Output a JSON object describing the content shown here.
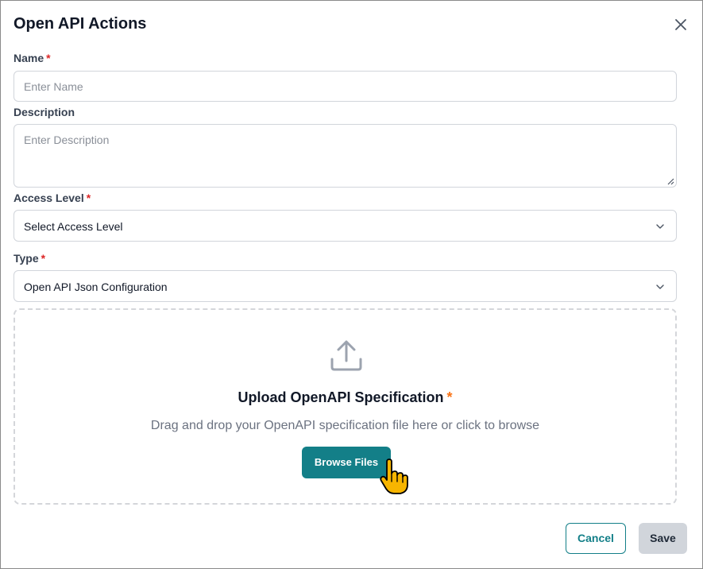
{
  "dialog": {
    "title": "Open API Actions",
    "close_icon": "close-icon"
  },
  "form": {
    "name": {
      "label": "Name",
      "required_mark": "*",
      "placeholder": "Enter Name",
      "value": ""
    },
    "description": {
      "label": "Description",
      "placeholder": "Enter Description",
      "value": ""
    },
    "access_level": {
      "label": "Access Level",
      "required_mark": "*",
      "selected": "Select Access Level"
    },
    "type": {
      "label": "Type",
      "required_mark": "*",
      "selected": "Open API Json Configuration"
    }
  },
  "upload": {
    "icon": "upload-icon",
    "title": "Upload OpenAPI Specification",
    "required_mark": "*",
    "subtitle": "Drag and drop your OpenAPI specification file here or click to browse",
    "browse_label": "Browse Files"
  },
  "footer": {
    "cancel_label": "Cancel",
    "save_label": "Save"
  },
  "colors": {
    "accent": "#137f88",
    "required": "#dc2626",
    "upload_required": "#f97316",
    "save_disabled_bg": "#d1d5db"
  }
}
